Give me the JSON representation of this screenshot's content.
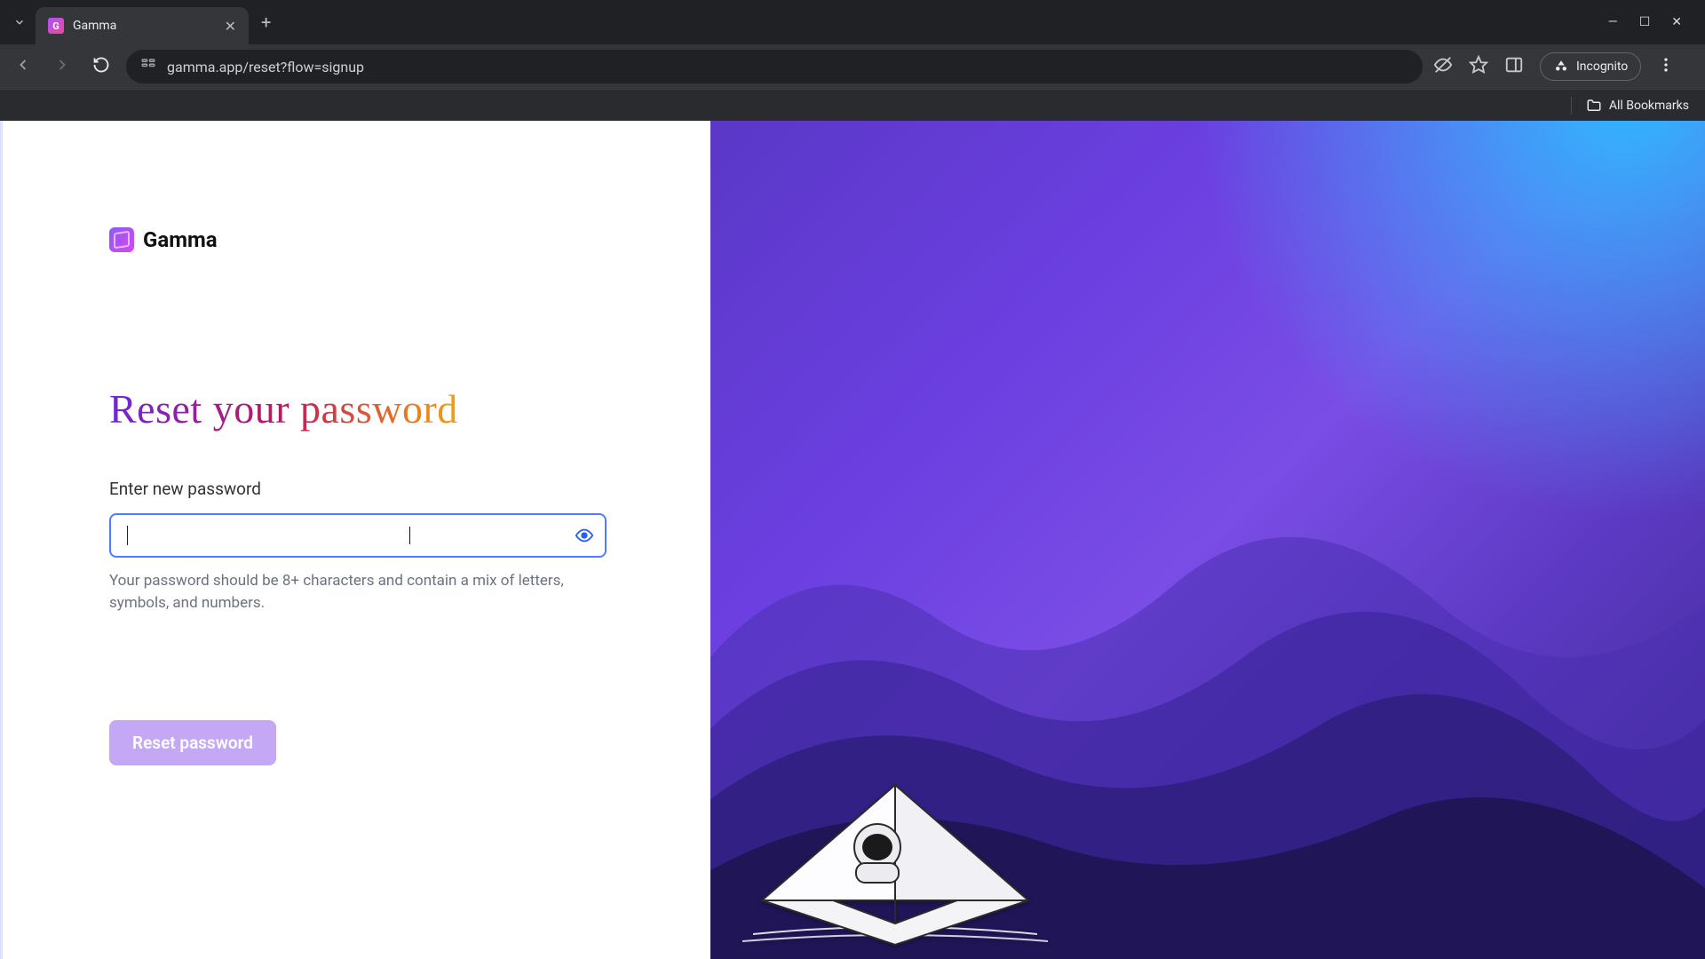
{
  "browser": {
    "tab_title": "Gamma",
    "url_display": "gamma.app/reset?flow=signup",
    "incognito_label": "Incognito",
    "bookmarks_label": "All Bookmarks"
  },
  "page": {
    "brand_name": "Gamma",
    "heading": "Reset your password",
    "password_label": "Enter new password",
    "password_value": "",
    "password_hint": "Your password should be 8+ characters and contain a mix of letters, symbols, and numbers.",
    "submit_label": "Reset password"
  }
}
